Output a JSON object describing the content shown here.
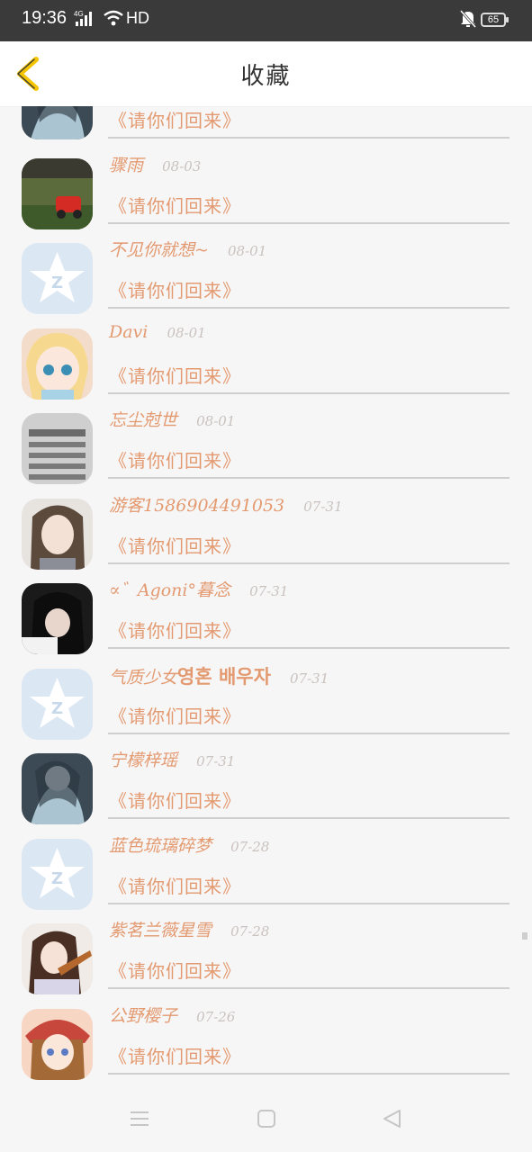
{
  "status_bar": {
    "time": "19:36",
    "network": "4G",
    "hd": "HD",
    "battery": "65"
  },
  "header": {
    "title": "收藏",
    "back_icon": "chevron-left-icon",
    "accent_color": "#f5c400"
  },
  "favorites": [
    {
      "name": "",
      "date": "",
      "snippet": "《请你们回来》",
      "avatar": "anime-girl-dark"
    },
    {
      "name": "骤雨",
      "date": "08-03",
      "snippet": "《请你们回来》",
      "avatar": "racing-photo"
    },
    {
      "name": "不见你就想~",
      "date": "08-01",
      "snippet": "《请你们回来》",
      "avatar": "default-qq"
    },
    {
      "name": "Davi",
      "date": "08-01",
      "snippet": "《请你们回来》",
      "avatar": "anime-blonde"
    },
    {
      "name": "忘尘尅世",
      "date": "08-01",
      "snippet": "《请你们回来》",
      "avatar": "grayscale-text"
    },
    {
      "name": "游客1586904491053",
      "date": "07-31",
      "snippet": "《请你们回来》",
      "avatar": "anime-brunette"
    },
    {
      "name": "∝゛Agoni°暮念",
      "date": "07-31",
      "snippet": "《请你们回来》",
      "avatar": "dark-hair-photo"
    },
    {
      "name": "气质少女",
      "name_extra": "영혼 배우자",
      "date": "07-31",
      "snippet": "《请你们回来》",
      "avatar": "default-qq"
    },
    {
      "name": "宁檬梓瑶",
      "date": "07-31",
      "snippet": "《请你们回来》",
      "avatar": "anime-girl-dark"
    },
    {
      "name": "蓝色琉璃碎梦",
      "date": "07-28",
      "snippet": "《请你们回来》",
      "avatar": "default-qq"
    },
    {
      "name": "紫茗兰薇星雪",
      "date": "07-28",
      "snippet": "《请你们回来》",
      "avatar": "anime-violin"
    },
    {
      "name": "公野樱子",
      "date": "07-26",
      "snippet": "《请你们回来》",
      "avatar": "anime-pinkhat"
    }
  ],
  "nav": {
    "menu_icon": "menu-icon",
    "home_icon": "square-home-icon",
    "back_icon": "triangle-back-icon"
  }
}
